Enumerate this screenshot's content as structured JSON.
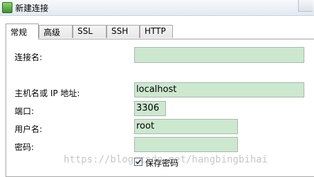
{
  "window": {
    "title": "新建连接"
  },
  "tabs": [
    {
      "label": "常规",
      "active": true
    },
    {
      "label": "高级",
      "active": false
    },
    {
      "label": "SSL",
      "active": false
    },
    {
      "label": "SSH",
      "active": false
    },
    {
      "label": "HTTP",
      "active": false
    }
  ],
  "form": {
    "connection_name": {
      "label": "连接名:",
      "value": ""
    },
    "host": {
      "label": "主机名或 IP 地址:",
      "value": "localhost"
    },
    "port": {
      "label": "端口:",
      "value": "3306"
    },
    "username": {
      "label": "用户名:",
      "value": "root"
    },
    "password": {
      "label": "密码:",
      "value": ""
    },
    "save_password": {
      "label": "保存密码",
      "checked": true
    }
  },
  "watermark": "https://blog.csdn.net/hangbingbihai",
  "colors": {
    "field_bg": "#cce8cf",
    "tab_border": "#a6a6a6"
  }
}
